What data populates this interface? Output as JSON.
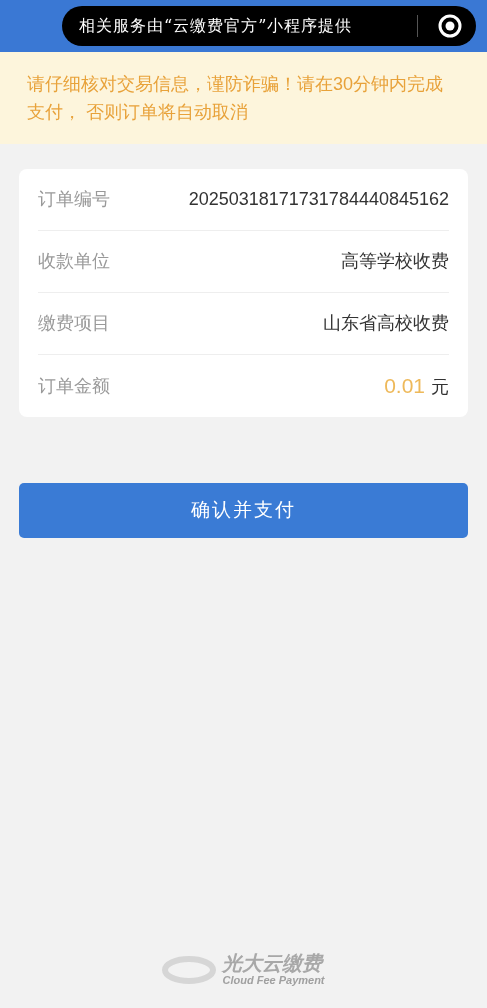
{
  "capsule": {
    "text": "相关服务由“云缴费官方”小程序提供"
  },
  "notice": "请仔细核对交易信息，谨防诈骗！请在30分钟内完成支付， 否则订单将自动取消",
  "order_rows": [
    {
      "kind": "text",
      "label": "订单编号",
      "value": "20250318171731784440845162"
    },
    {
      "kind": "text",
      "label": "收款单位",
      "value": "高等学校收费"
    },
    {
      "kind": "text",
      "label": "缴费项目",
      "value": "山东省高校收费"
    },
    {
      "kind": "amount",
      "label": "订单金额",
      "value": "0.01",
      "unit": "元"
    }
  ],
  "pay_button": "确认并支付",
  "footer": {
    "brand": "光大云缴费",
    "tagline": "Cloud Fee Payment"
  }
}
